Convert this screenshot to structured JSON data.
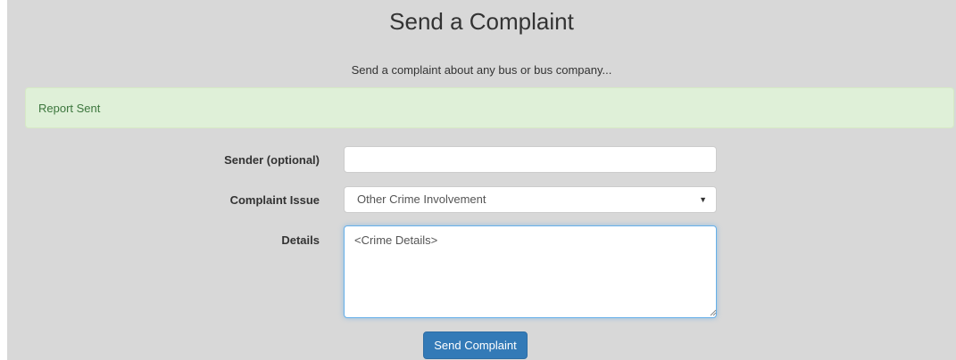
{
  "header": {
    "title": "Send a Complaint",
    "subtitle": "Send a complaint about any bus or bus company..."
  },
  "alert": {
    "message": "Report Sent",
    "status": "success"
  },
  "form": {
    "sender": {
      "label": "Sender (optional)",
      "value": ""
    },
    "issue": {
      "label": "Complaint Issue",
      "selected": "Other Crime Involvement",
      "arrow_icon": "caret-down-icon"
    },
    "details": {
      "label": "Details",
      "value": "<Crime Details>"
    },
    "submit_label": "Send Complaint"
  },
  "colors": {
    "background": "#d8d8d8",
    "alert_bg": "#dff0d8",
    "alert_text": "#3c763d",
    "button_bg": "#337ab7",
    "focus_border": "#66afe9"
  }
}
